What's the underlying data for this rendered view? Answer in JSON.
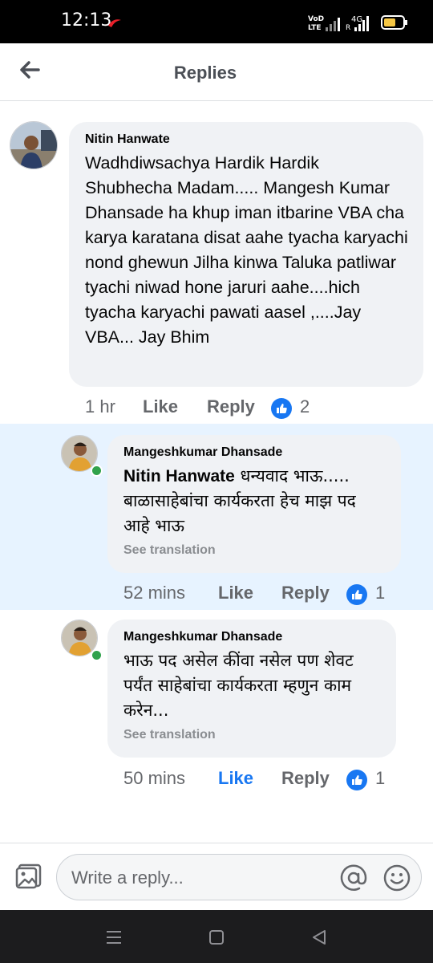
{
  "status_bar": {
    "time": "12:13",
    "network_label": "4G"
  },
  "header": {
    "title": "Replies"
  },
  "comments": [
    {
      "author": "Nitin Hanwate",
      "text": "Wadhdiwsachya Hardik Hardik Shubhecha Madam..... Mangesh Kumar Dhansade ha khup iman itbarine VBA cha karya karatana disat aahe tyacha karyachi nond ghewun Jilha kinwa Taluka patliwar tyachi niwad hone jaruri aahe....hich tyacha karyachi pawati aasel ,....Jay VBA... Jay Bhim",
      "time": "1 hr",
      "like_label": "Like",
      "reply_label": "Reply",
      "reaction_count": "2"
    },
    {
      "author": "Mangeshkumar Dhansade",
      "mention": "Nitin Hanwate",
      "text": " धन्यवाद भाऊ..... बाळासाहेबांचा कार्यकरता हेच माझ पद आहे भाऊ",
      "see_translation": "See translation",
      "time": "52 mins",
      "like_label": "Like",
      "reply_label": "Reply",
      "reaction_count": "1"
    },
    {
      "author": "Mangeshkumar Dhansade",
      "text": "भाऊ पद असेल कींवा नसेल पण शेवट पर्यंत साहेबांचा कार्यकरता म्हणुन काम करेन...",
      "see_translation": "See translation",
      "time": "50 mins",
      "like_label": "Like",
      "reply_label": "Reply",
      "reaction_count": "1"
    }
  ],
  "composer": {
    "placeholder": "Write a reply..."
  },
  "colors": {
    "accent": "#1877f2",
    "highlight": "#e7f3ff",
    "bubble": "#f0f2f5",
    "online": "#31a24c"
  },
  "icons": [
    "back-arrow-icon",
    "like-reaction-icon",
    "photo-icon",
    "at-icon",
    "emoji-icon",
    "recents-icon",
    "home-icon",
    "nav-back-icon"
  ]
}
